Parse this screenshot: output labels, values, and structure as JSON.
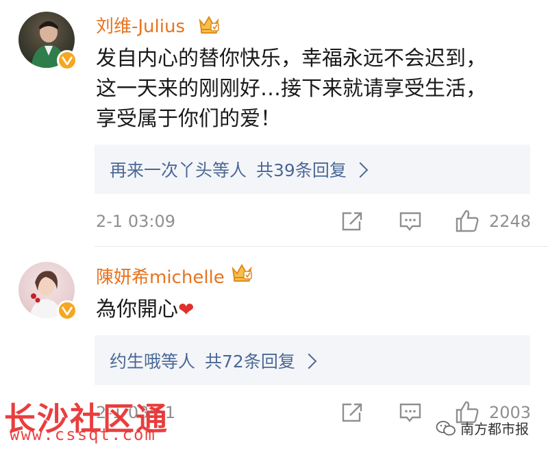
{
  "comments": [
    {
      "username": "刘维-Julius",
      "text_lines": [
        "发自内心的替你快乐，幸福永远不会迟到，",
        "这一天来的刚刚好…接下来就请享受生活，",
        "享受属于你们的爱！"
      ],
      "replies": {
        "names": "再来一次丫头等人",
        "summary": "共39条回复"
      },
      "time": "2-1 03:09",
      "likes": "2248"
    },
    {
      "username": "陳妍希michelle",
      "text": "為你開心",
      "emoji": "❤",
      "replies": {
        "names": "约生哦等人",
        "summary": "共72条回复"
      },
      "time": "2-1 03:51",
      "likes": "2003"
    }
  ],
  "watermark": {
    "title": "长沙社区通",
    "url": "www.cssqt.com"
  },
  "source_label": "南方都市报",
  "colors": {
    "username": "#e8731c",
    "reply_link": "#4a6896",
    "meta": "#8f8f8f",
    "heart": "#e0302a",
    "watermark": "#e83030"
  }
}
